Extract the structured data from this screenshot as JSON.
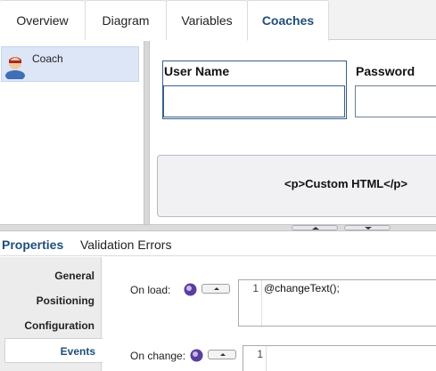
{
  "top_tabs": [
    {
      "label": "Overview"
    },
    {
      "label": "Diagram"
    },
    {
      "label": "Variables"
    },
    {
      "label": "Coaches"
    }
  ],
  "active_top_tab": "Coaches",
  "coach_list": {
    "items": [
      {
        "label": "Coach",
        "icon": "person-icon"
      }
    ]
  },
  "canvas": {
    "username_label": "User Name",
    "password_label": "Password",
    "custom_html_text": "<p>Custom HTML</p>"
  },
  "properties": {
    "tabs": [
      {
        "label": "Properties"
      },
      {
        "label": "Validation Errors"
      }
    ],
    "active_tab": "Properties",
    "nav": [
      {
        "label": "General"
      },
      {
        "label": "Positioning"
      },
      {
        "label": "Configuration"
      },
      {
        "label": "Events"
      }
    ],
    "active_nav": "Events"
  },
  "events": {
    "on_load": {
      "label": "On load:",
      "line_number": "1",
      "code": "@changeText();"
    },
    "on_change": {
      "label": "On change:",
      "line_number": "1",
      "code": ""
    }
  },
  "colors": {
    "accent": "#1f4e79",
    "selection": "#dde6f7",
    "icon_purple": "#5b3e9c"
  }
}
